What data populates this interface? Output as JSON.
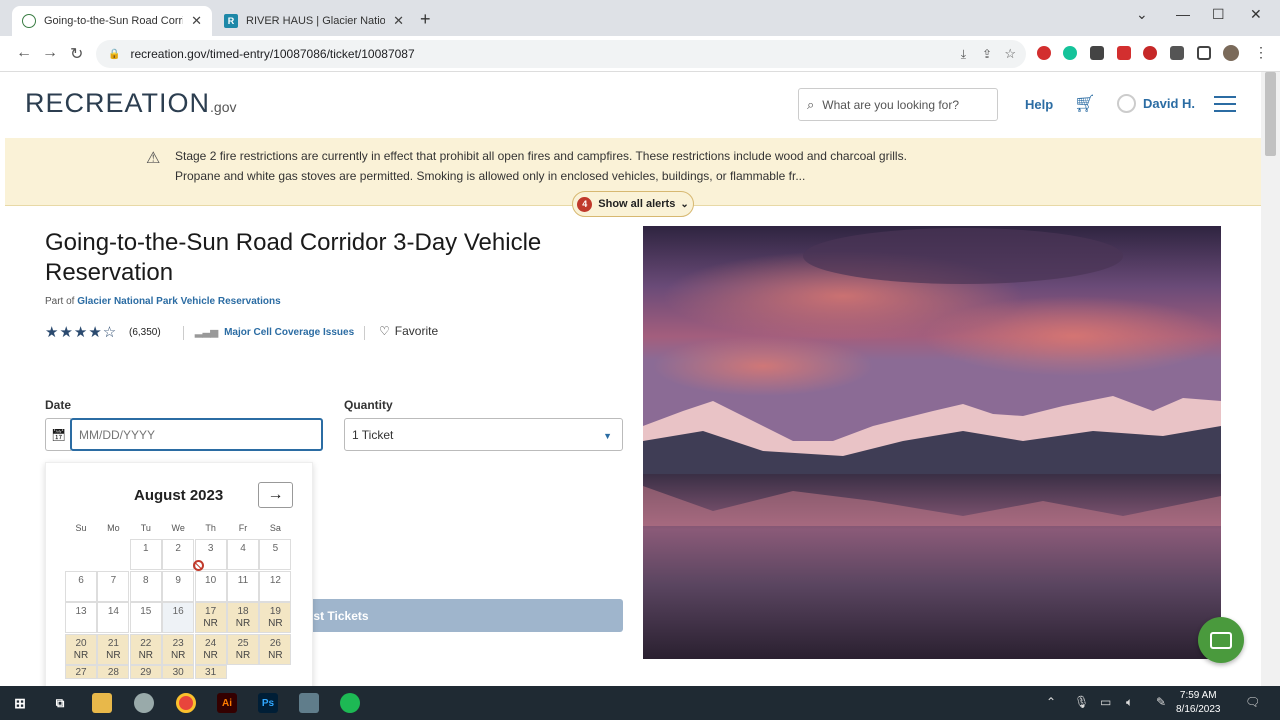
{
  "browser": {
    "tabs": [
      {
        "title": "Going-to-the-Sun Road Corridor",
        "active": true
      },
      {
        "title": "RIVER HAUS | Glacier National Pa",
        "active": false
      }
    ],
    "url": "recreation.gov/timed-entry/10087086/ticket/10087087"
  },
  "header": {
    "logo": "RECREATION",
    "logo_suffix": ".gov",
    "search_placeholder": "What are you looking for?",
    "help": "Help",
    "user": "David H."
  },
  "alert": {
    "text": "Stage 2 fire restrictions are currently in effect that prohibit all open fires and campfires. These restrictions include wood and charcoal grills. Propane and white gas stoves are permitted. Smoking is allowed only in enclosed vehicles, buildings, or flammable fr...",
    "count": "4",
    "button": "Show all alerts"
  },
  "facility": {
    "title": "Going-to-the-Sun Road Corridor 3-Day Vehicle Reservation",
    "part_of_prefix": "Part of",
    "part_of_link": "Glacier National Park Vehicle Reservations",
    "stars": "★★★★☆",
    "rating_count": "(6,350)",
    "cell": "Major Cell Coverage Issues",
    "favorite": "Favorite"
  },
  "booking": {
    "date_label": "Date",
    "date_placeholder": "MM/DD/YYYY",
    "quantity_label": "Quantity",
    "quantity_value": "1 Ticket",
    "request_button": "uest Tickets"
  },
  "calendar": {
    "month": "August 2023",
    "weekdays": [
      "Su",
      "Mo",
      "Tu",
      "We",
      "Th",
      "Fr",
      "Sa"
    ],
    "weeks": [
      [
        "",
        "",
        "1",
        "2",
        "3",
        "4",
        "5"
      ],
      [
        "6",
        "7",
        "8",
        "9",
        "10",
        "11",
        "12"
      ],
      [
        "13",
        "14",
        "15",
        "16",
        "17",
        "18",
        "19"
      ],
      [
        "20",
        "21",
        "22",
        "23",
        "24",
        "25",
        "26"
      ],
      [
        "27",
        "28",
        "29",
        "30",
        "31",
        "",
        ""
      ]
    ],
    "nr_label": "NR"
  },
  "taskbar": {
    "time": "7:59 AM",
    "date": "8/16/2023"
  },
  "colors": {
    "brand": "#2b6ca3",
    "alert_bg": "#faf2d7",
    "nr_bg": "#f3e6c4",
    "chat": "#4a9a3d"
  }
}
